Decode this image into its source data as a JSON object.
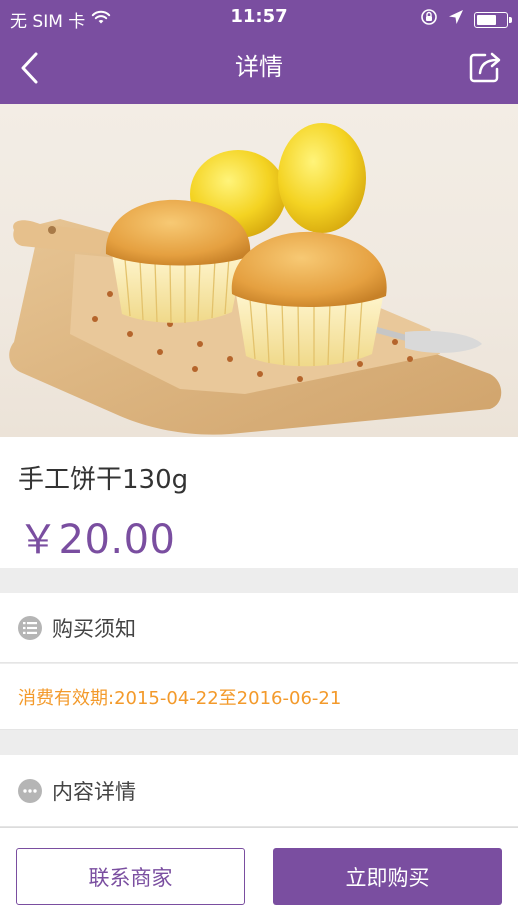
{
  "status_bar": {
    "carrier": "无 SIM 卡",
    "time": "11:57"
  },
  "nav": {
    "title": "详情",
    "back_icon": "chevron-left-icon",
    "share_icon": "share-icon"
  },
  "hero_image": {
    "subject": "muffins-and-lemons-photo"
  },
  "product": {
    "name": "手工饼干130g",
    "price": "￥20.00"
  },
  "purchase_notice": {
    "label": "购买须知",
    "icon": "list-icon",
    "validity_label": "消费有效期:",
    "validity_range": "2015-04-22至2016-06-21"
  },
  "content_details": {
    "label": "内容详情",
    "icon": "more-dots-icon"
  },
  "actions": {
    "contact_label": "联系商家",
    "buy_label": "立即购买"
  },
  "colors": {
    "accent": "#7a4ea0",
    "validity": "#f39a2b"
  }
}
